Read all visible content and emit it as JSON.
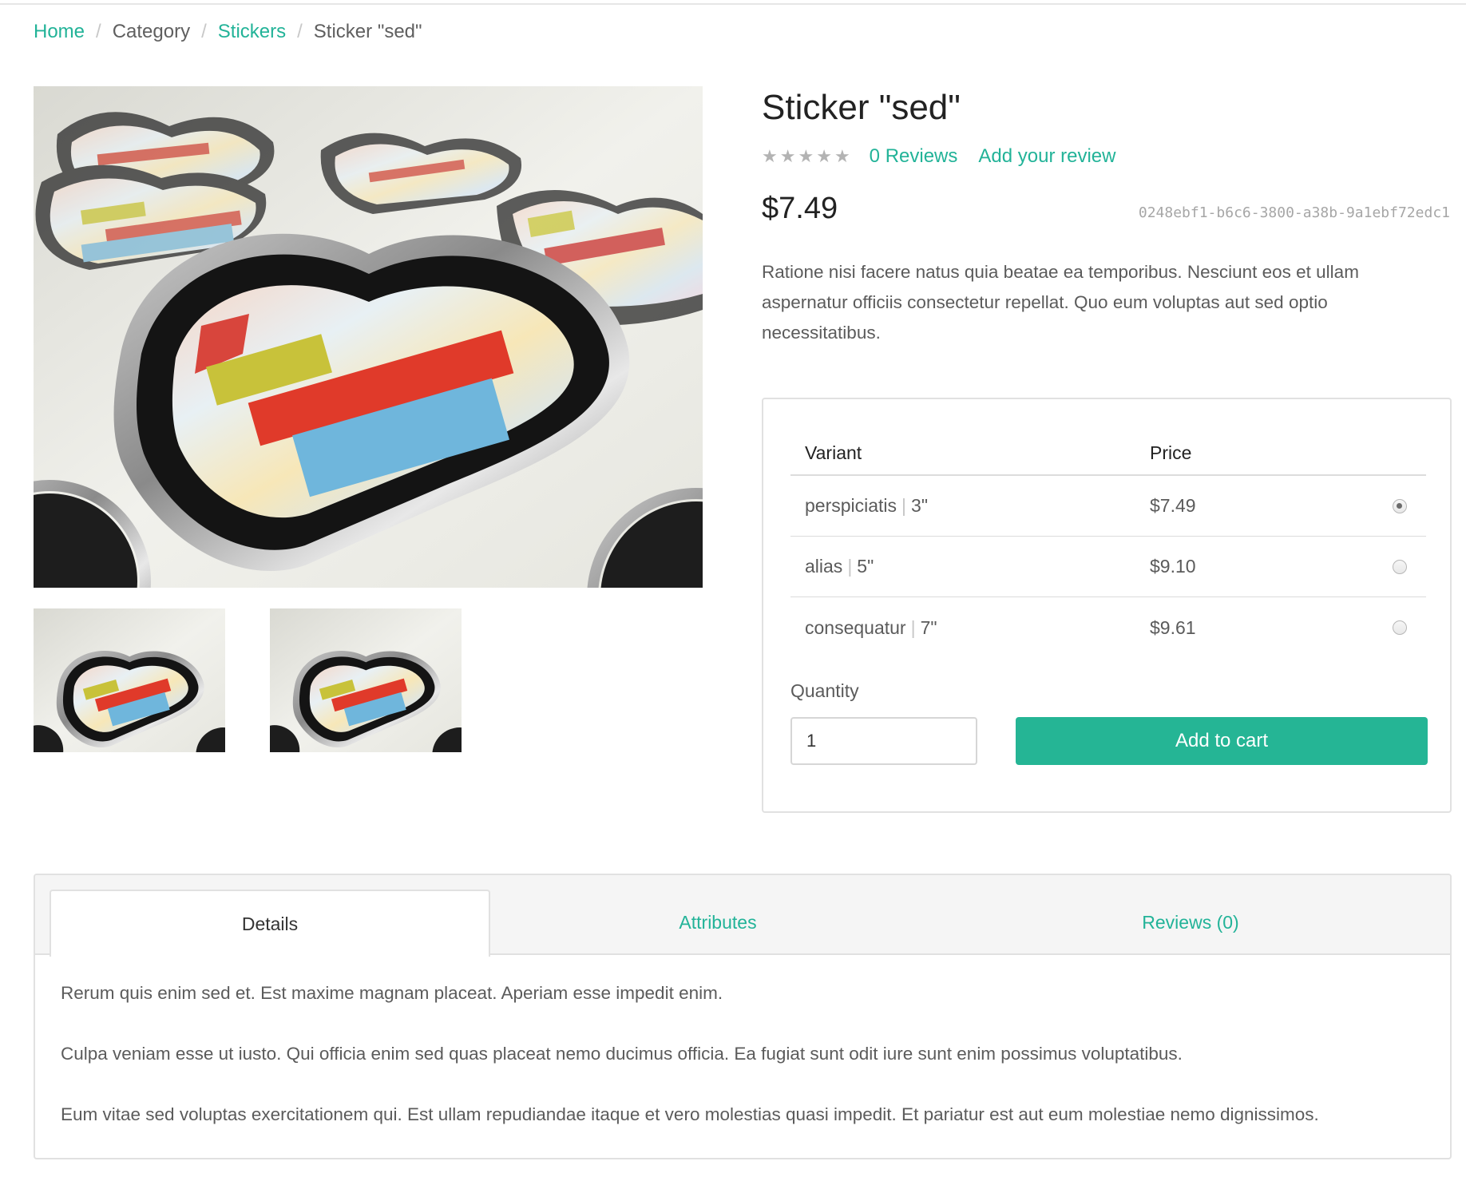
{
  "breadcrumb": {
    "home": "Home",
    "category": "Category",
    "stickers": "Stickers",
    "current": "Sticker \"sed\"",
    "separator": "/"
  },
  "product": {
    "title": "Sticker \"sed\"",
    "rating_stars": 0,
    "reviews_link": "0 Reviews",
    "add_review_link": "Add your review",
    "price": "$7.49",
    "sku": "0248ebf1-b6c6-3800-a38b-9a1ebf72edc1",
    "description": "Ratione nisi facere natus quia beatae ea temporibus. Nesciunt eos et ullam aspernatur officiis consectetur repellat. Quo eum voluptas aut sed optio necessitatibus."
  },
  "variants": {
    "header_variant": "Variant",
    "header_price": "Price",
    "rows": [
      {
        "name": "perspiciatis",
        "size": "3\"",
        "price": "$7.49",
        "selected": true
      },
      {
        "name": "alias",
        "size": "5\"",
        "price": "$9.10",
        "selected": false
      },
      {
        "name": "consequatur",
        "size": "7\"",
        "price": "$9.61",
        "selected": false
      }
    ],
    "size_separator": "|",
    "quantity_label": "Quantity",
    "quantity_value": "1",
    "add_to_cart": "Add to cart"
  },
  "tabs": {
    "items": [
      {
        "label": "Details",
        "active": true
      },
      {
        "label": "Attributes",
        "active": false
      },
      {
        "label": "Reviews (0)",
        "active": false
      }
    ],
    "details_paragraphs": [
      "Rerum quis enim sed et. Est maxime magnam placeat. Aperiam esse impedit enim.",
      "Culpa veniam esse ut iusto. Qui officia enim sed quas placeat nemo ducimus officia. Ea fugiat sunt odit iure sunt enim possimus voluptatibus.",
      "Eum vitae sed voluptas exercitationem qui. Est ullam repudiandae itaque et vero molestias quasi impedit. Et pariatur est aut eum molestiae nemo dignissimos."
    ]
  },
  "colors": {
    "accent": "#22b398",
    "button": "#25b595",
    "star_empty": "#b3b3b3"
  },
  "icons": {
    "star": "star-icon",
    "radio": "radio-button"
  }
}
